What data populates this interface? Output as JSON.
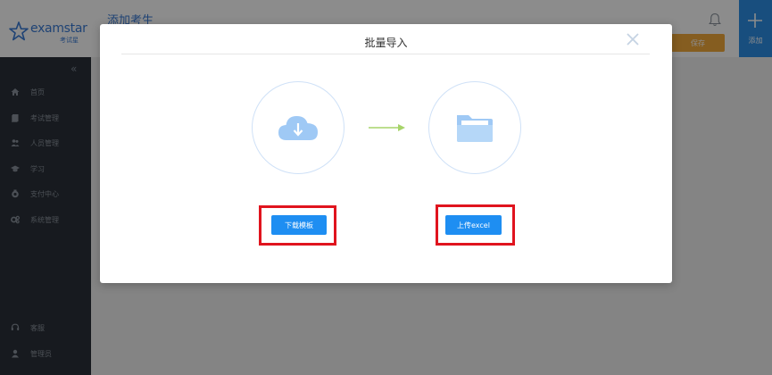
{
  "sidebar": {
    "logo_text": "examstar",
    "logo_sub": "考试星",
    "collapse_glyph": "«",
    "items": [
      {
        "label": "首页",
        "icon": "home-icon"
      },
      {
        "label": "考试管理",
        "icon": "exam-icon"
      },
      {
        "label": "人员管理",
        "icon": "users-icon"
      },
      {
        "label": "学习",
        "icon": "graduation-cap-icon"
      },
      {
        "label": "支付中心",
        "icon": "payment-icon"
      },
      {
        "label": "系统管理",
        "icon": "gears-icon"
      }
    ],
    "bottom_items": [
      {
        "label": "客服",
        "icon": "headset-icon"
      },
      {
        "label": "管理员",
        "icon": "user-icon"
      }
    ]
  },
  "header": {
    "page_title": "添加考生",
    "save_label": "保存",
    "add_label": "添加"
  },
  "modal": {
    "title": "批量导入",
    "download_button": "下载模板",
    "upload_button": "上传excel"
  },
  "colors": {
    "brand": "#3a7bd5",
    "primary_button": "#1e8ef2",
    "highlight": "#e0141e",
    "icon_light": "#9fc9f5",
    "arrow": "#a7d46a"
  }
}
